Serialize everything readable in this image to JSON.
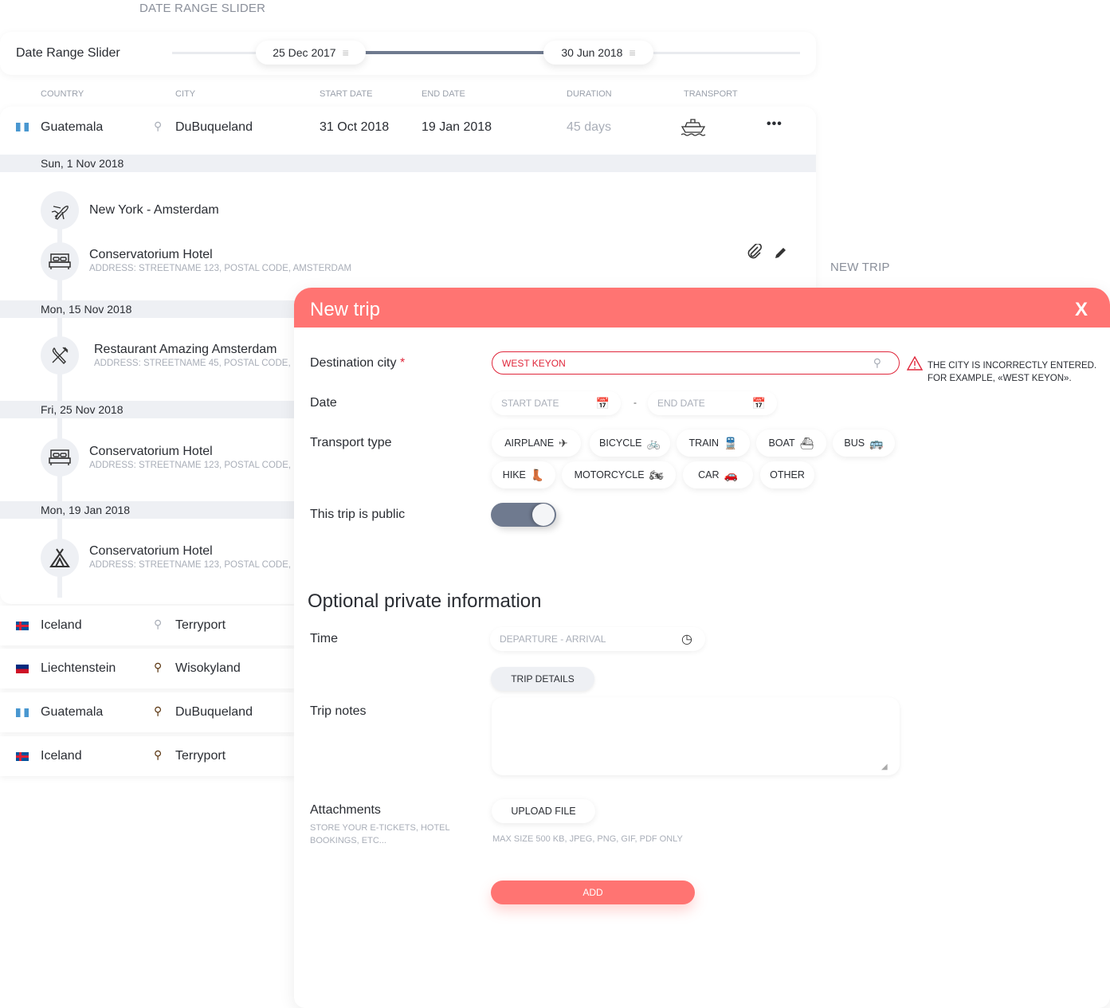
{
  "sections": {
    "date_range_slider": "DATE RANGE SLIDER",
    "new_trip": "NEW TRIP"
  },
  "slider": {
    "label": "Date Range Slider",
    "start": "25 Dec 2017",
    "end": "30 Jun 2018"
  },
  "table": {
    "columns": [
      "COUNTRY",
      "CITY",
      "START DATE",
      "END DATE",
      "DURATION",
      "TRANSPORT"
    ],
    "expanded_row": {
      "country": "Guatemala",
      "city": "DuBuqueland",
      "start": "31 Oct 2018",
      "end": "19 Jan 2018",
      "duration": "45 days",
      "transport_icon": "ship-icon",
      "more": "•••"
    },
    "days": [
      {
        "date": "Sun, 1 Nov 2018",
        "events": [
          {
            "title": "New York - Amsterdam",
            "icon": "airplane-icon"
          },
          {
            "title": "Conservatorium Hotel",
            "address": "ADDRESS: STREETNAME 123, POSTAL CODE, AMSTERDAM",
            "icon": "bed-icon"
          }
        ]
      },
      {
        "date": "Mon, 15 Nov 2018",
        "events": [
          {
            "title": "Restaurant Amazing Amsterdam",
            "address": "ADDRESS: STREETNAME 45, POSTAL CODE,",
            "icon": "fork-knife-icon"
          }
        ]
      },
      {
        "date": "Fri, 25 Nov 2018",
        "events": [
          {
            "title": "Conservatorium Hotel",
            "address": "ADDRESS: STREETNAME 123, POSTAL CODE,",
            "icon": "bed-icon"
          }
        ]
      },
      {
        "date": "Mon, 19 Jan 2018",
        "events": [
          {
            "title": "Conservatorium Hotel",
            "address": "ADDRESS: STREETNAME 123, POSTAL CODE,",
            "icon": "tent-icon"
          }
        ]
      }
    ],
    "rows": [
      {
        "country": "Iceland",
        "city": "Terryport"
      },
      {
        "country": "Liechtenstein",
        "city": "Wisokyland"
      },
      {
        "country": "Guatemala",
        "city": "DuBuqueland"
      },
      {
        "country": "Iceland",
        "city": "Terryport"
      }
    ]
  },
  "modal": {
    "title": "New trip",
    "close": "X",
    "destination": {
      "label": "Destination city",
      "required": "*",
      "value": "WEST KEYON",
      "error": "THE CITY IS INCORRECTLY ENTERED.",
      "error2": "FOR EXAMPLE, «WEST KEYON»."
    },
    "date": {
      "label": "Date",
      "start_placeholder": "START DATE",
      "end_placeholder": "END DATE",
      "sep": "-"
    },
    "transport": {
      "label": "Transport type",
      "options": [
        "AIRPLANE",
        "BICYCLE",
        "TRAIN",
        "BOAT",
        "BUS",
        "HIKE",
        "MOTORCYCLE",
        "CAR",
        "OTHER"
      ]
    },
    "public": {
      "label": "This trip is public",
      "on": true
    },
    "optional_title": "Optional private information",
    "time": {
      "label": "Time",
      "placeholder": "DEPARTURE - ARRIVAL"
    },
    "trip_details": "TRIP DETAILS",
    "notes": {
      "label": "Trip notes",
      "value": ""
    },
    "attachments": {
      "label": "Attachments",
      "hint": "STORE YOUR E-TICKETS, HOTEL",
      "hint2": "BOOKINGS, ETC...",
      "upload": "UPLOAD FILE",
      "limits": "MAX SIZE 500 KB, JPEG, PNG, GIF, PDF ONLY"
    },
    "add": "ADD"
  },
  "colors": {
    "accent": "#ff7472",
    "error": "#e0283c",
    "slider_fill": "#6f7a8f"
  }
}
